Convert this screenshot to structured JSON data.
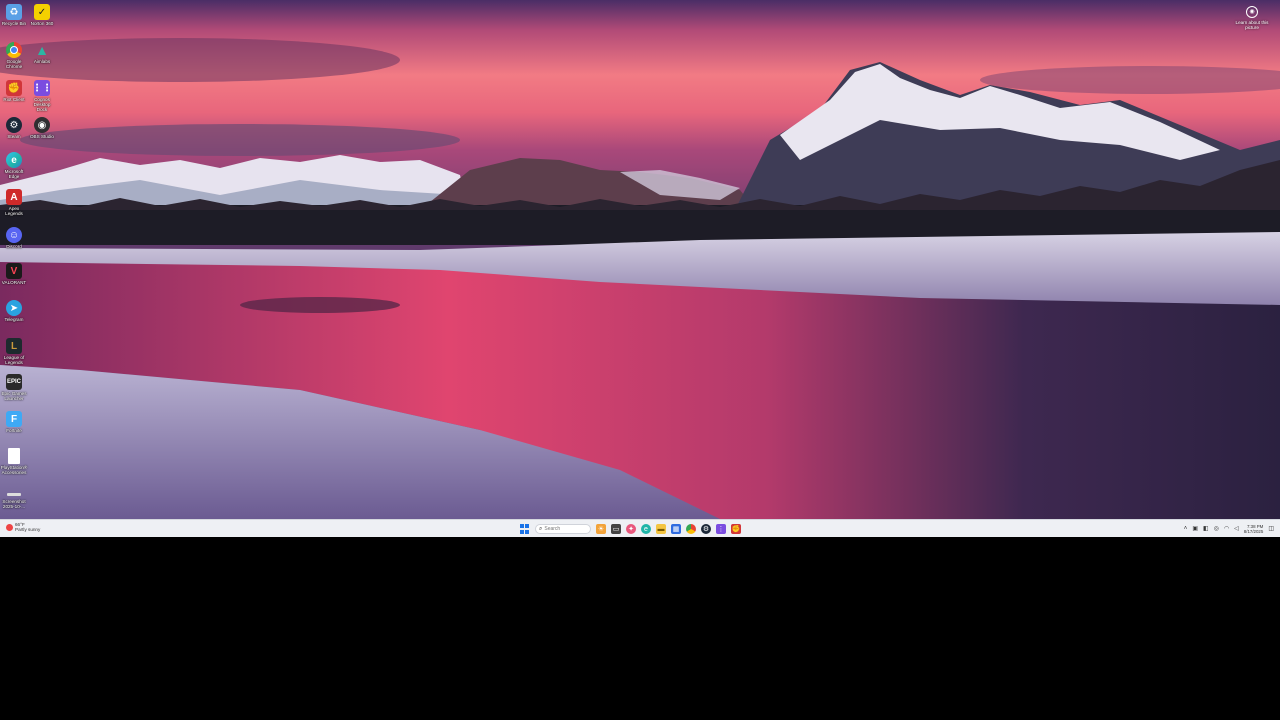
{
  "desktop": {
    "icons": [
      {
        "label": "Recycle Bin",
        "icon": "recycle-bin-icon",
        "color": "#5aa0e6"
      },
      {
        "label": "Norton 360",
        "icon": "norton-icon",
        "color": "#f5d000"
      },
      {
        "label": "Google Chrome",
        "icon": "chrome-icon",
        "color": "#34a853"
      },
      {
        "label": "Aimlabs",
        "icon": "aimlabs-icon",
        "color": "#2bb6a3"
      },
      {
        "label": "Riot Client",
        "icon": "riot-client-icon",
        "color": "#d13639"
      },
      {
        "label": "Cognos Desktop Dock",
        "icon": "dock-icon",
        "color": "#7b4de0"
      },
      {
        "label": "Steam",
        "icon": "steam-icon",
        "color": "#1b2838"
      },
      {
        "label": "OBS Studio",
        "icon": "obs-icon",
        "color": "#302e31"
      },
      {
        "label": "Microsoft Edge",
        "icon": "edge-icon",
        "color": "#1fb5a8"
      },
      {
        "label": "Apex Legends",
        "icon": "apex-icon",
        "color": "#cf2a2a"
      },
      {
        "label": "Discord",
        "icon": "discord-icon",
        "color": "#5865f2"
      },
      {
        "label": "VALORANT",
        "icon": "valorant-icon",
        "color": "#fd4556"
      },
      {
        "label": "Telegram",
        "icon": "telegram-icon",
        "color": "#2aa3e0"
      },
      {
        "label": "League of Legends",
        "icon": "league-icon",
        "color": "#c89b3c"
      },
      {
        "label": "Epic Games Launcher",
        "icon": "epic-icon",
        "color": "#2a2a2a"
      },
      {
        "label": "Fortnite",
        "icon": "fortnite-icon",
        "color": "#3fa9f5"
      },
      {
        "label": "PlayStation® Accessories",
        "icon": "file-icon",
        "color": "#ffffff"
      },
      {
        "label": "Screenshot 2025-10-...",
        "icon": "screenshot-icon",
        "color": "#dddddd"
      }
    ],
    "learn_about": {
      "label": "Learn about this picture",
      "icon": "camera-icon"
    }
  },
  "taskbar": {
    "weather": {
      "temp": "66°F",
      "condition": "Partly sunny",
      "icon": "weather-icon"
    },
    "search_placeholder": "Search",
    "apps": [
      {
        "name": "widgets",
        "icon": "widgets-icon",
        "color": "#f2a33a"
      },
      {
        "name": "task-view",
        "icon": "task-view-icon",
        "color": "#444444"
      },
      {
        "name": "copilot",
        "icon": "copilot-icon",
        "color": "#e8577c"
      },
      {
        "name": "edge",
        "icon": "edge-icon",
        "color": "#1fb5a8"
      },
      {
        "name": "file-explorer",
        "icon": "folder-icon",
        "color": "#f4c542"
      },
      {
        "name": "store",
        "icon": "store-icon",
        "color": "#2f6ce0"
      },
      {
        "name": "chrome",
        "icon": "chrome-icon",
        "color": "#34a853"
      },
      {
        "name": "steam",
        "icon": "steam-icon",
        "color": "#1b2838"
      },
      {
        "name": "dock",
        "icon": "dock-icon",
        "color": "#7b4de0"
      },
      {
        "name": "riot",
        "icon": "riot-client-icon",
        "color": "#d13639"
      }
    ],
    "clock": {
      "time": "7:38 PM",
      "date": "8/17/2025"
    }
  }
}
